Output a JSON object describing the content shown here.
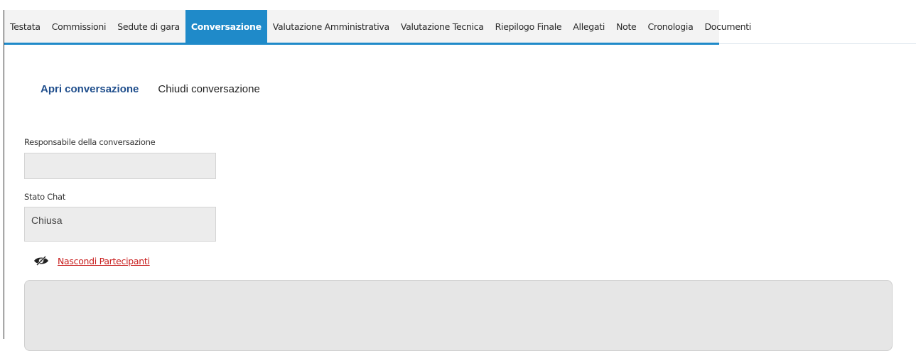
{
  "tabs": [
    {
      "label": "Testata",
      "active": false
    },
    {
      "label": "Commissioni",
      "active": false
    },
    {
      "label": "Sedute di gara",
      "active": false
    },
    {
      "label": "Conversazione",
      "active": true
    },
    {
      "label": "Valutazione Amministrativa",
      "active": false
    },
    {
      "label": "Valutazione Tecnica",
      "active": false
    },
    {
      "label": "Riepilogo Finale",
      "active": false
    },
    {
      "label": "Allegati",
      "active": false
    },
    {
      "label": "Note",
      "active": false
    },
    {
      "label": "Cronologia",
      "active": false
    },
    {
      "label": "Documenti",
      "active": false
    }
  ],
  "subtabs": {
    "open_label": "Apri conversazione",
    "close_label": "Chiudi conversazione"
  },
  "form": {
    "responsible_label": "Responsabile della conversazione",
    "responsible_value": "",
    "status_label": "Stato Chat",
    "status_value": "Chiusa"
  },
  "participants": {
    "toggle_icon": "eye-slash-icon",
    "toggle_label": "Nascondi Partecipanti"
  },
  "colors": {
    "accent": "#1f8ac9",
    "link_red": "#c81d1d",
    "active_subtab": "#1f4e8c"
  }
}
